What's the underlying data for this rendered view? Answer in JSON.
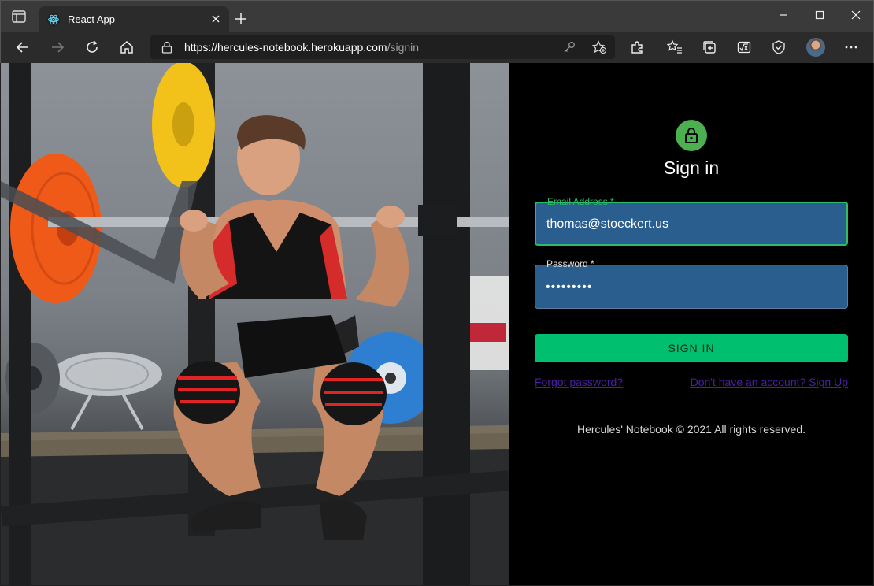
{
  "browser": {
    "tab_title": "React App",
    "url_host": "https://hercules-notebook.herokuapp.com",
    "url_path": "/signin"
  },
  "signin": {
    "title": "Sign in",
    "email_label": "Email Address *",
    "email_value": "thomas@stoeckert.us",
    "password_label": "Password *",
    "password_value": "•••••••••",
    "button_label": "SIGN IN",
    "forgot_link": "Forgot password?",
    "signup_link": "Don't have an account? Sign Up",
    "copyright": "Hercules' Notebook © 2021 All rights reserved."
  },
  "colors": {
    "accent_green": "#00bf6f",
    "lock_avatar": "#4caf50",
    "field_bg": "#2a5e8f",
    "link": "#4b1fa6"
  }
}
